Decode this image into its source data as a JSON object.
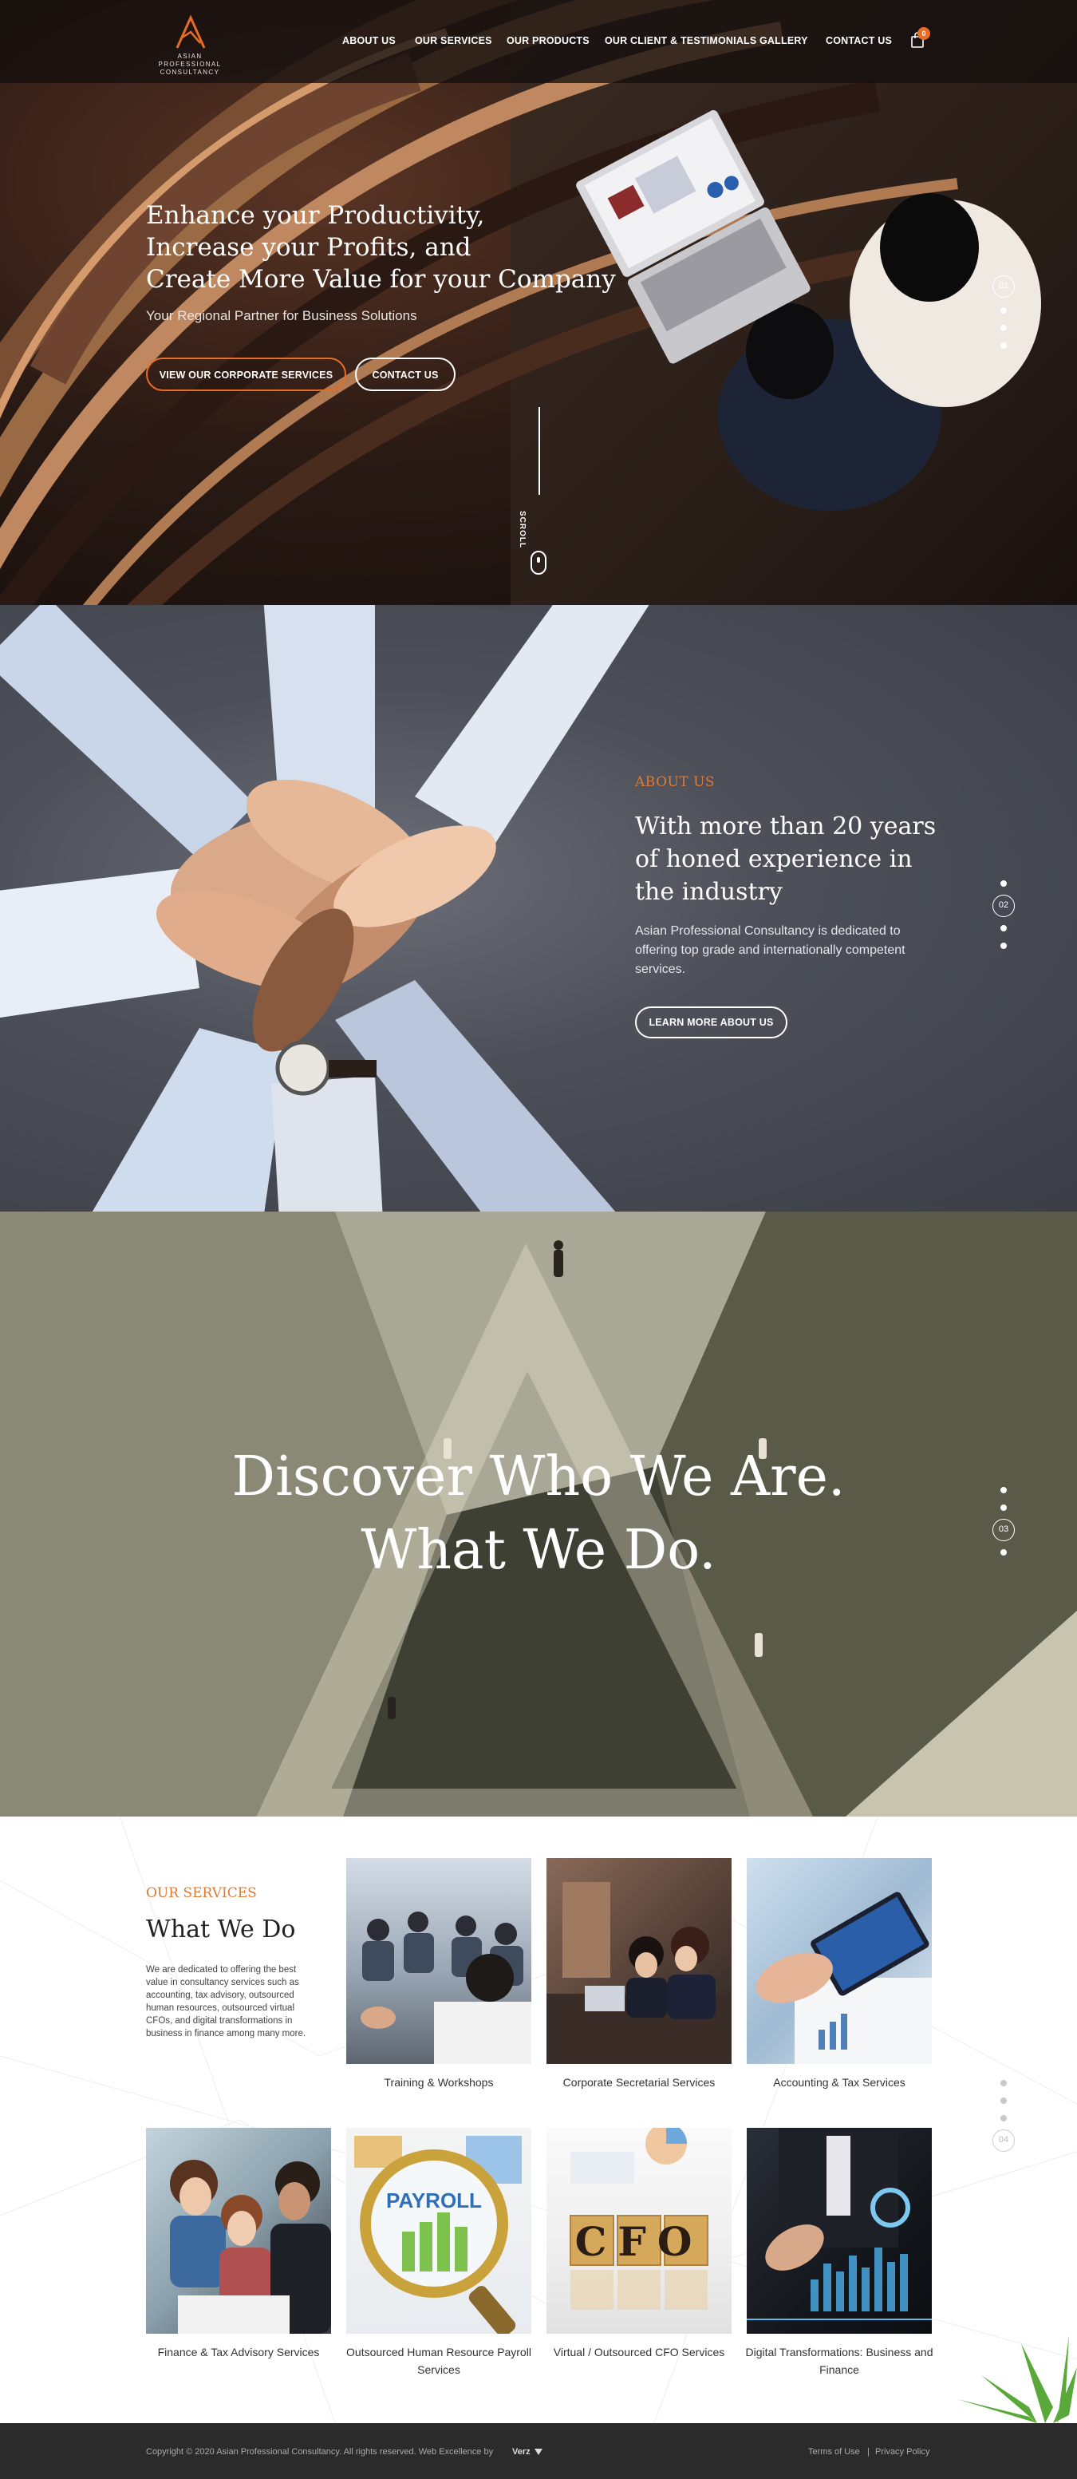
{
  "header": {
    "logo_text": "ASIAN PROFESSIONAL CONSULTANCY",
    "nav": [
      "ABOUT US",
      "OUR SERVICES",
      "OUR PRODUCTS",
      "OUR CLIENT & TESTIMONIALS",
      "GALLERY",
      "CONTACT US"
    ],
    "cart_count": "0",
    "cart_icon": "shopping-bag-icon"
  },
  "hero": {
    "title_line1": "Enhance your Productivity,",
    "title_line2": "Increase your Profits, and",
    "title_line3": "Create More Value for your Company",
    "subtitle": "Your Regional Partner for Business Solutions",
    "btn_services": "VIEW OUR CORPORATE SERVICES",
    "btn_contact": "CONTACT US",
    "scroll": "SCROLL",
    "slide_number": "01"
  },
  "about": {
    "label": "ABOUT US",
    "title": "With more than 20 years of honed experience in the industry",
    "text": "Asian Professional Consultancy is dedicated to offering top grade and internationally competent services.",
    "button": "LEARN MORE ABOUT US",
    "slide_number": "02"
  },
  "discover": {
    "line1": "Discover Who We Are.",
    "line2": "What We Do.",
    "slide_number": "03"
  },
  "services": {
    "label": "OUR SERVICES",
    "title": "What We Do",
    "text": "We are dedicated to offering the best value in consultancy services such as accounting, tax advisory, outsourced human resources, outsourced virtual CFOs, and digital transformations in business in finance among many more.",
    "slide_number": "04",
    "items": [
      "Training & Workshops",
      "Corporate Secretarial Services",
      "Accounting & Tax Services",
      "Finance & Tax Advisory Services",
      "Outsourced Human Resource Payroll Services",
      "Virtual / Outsourced CFO Services",
      "Digital Transformations: Business and Finance"
    ],
    "payroll_word": "PAYROLL",
    "cfo_word": "CFO"
  },
  "footer": {
    "copyright": "Copyright © 2020 Asian Professional Consultancy. All rights reserved. Web Excellence by",
    "brand": "Verz",
    "terms": "Terms of Use",
    "separator": "|",
    "privacy": "Privacy Policy"
  }
}
